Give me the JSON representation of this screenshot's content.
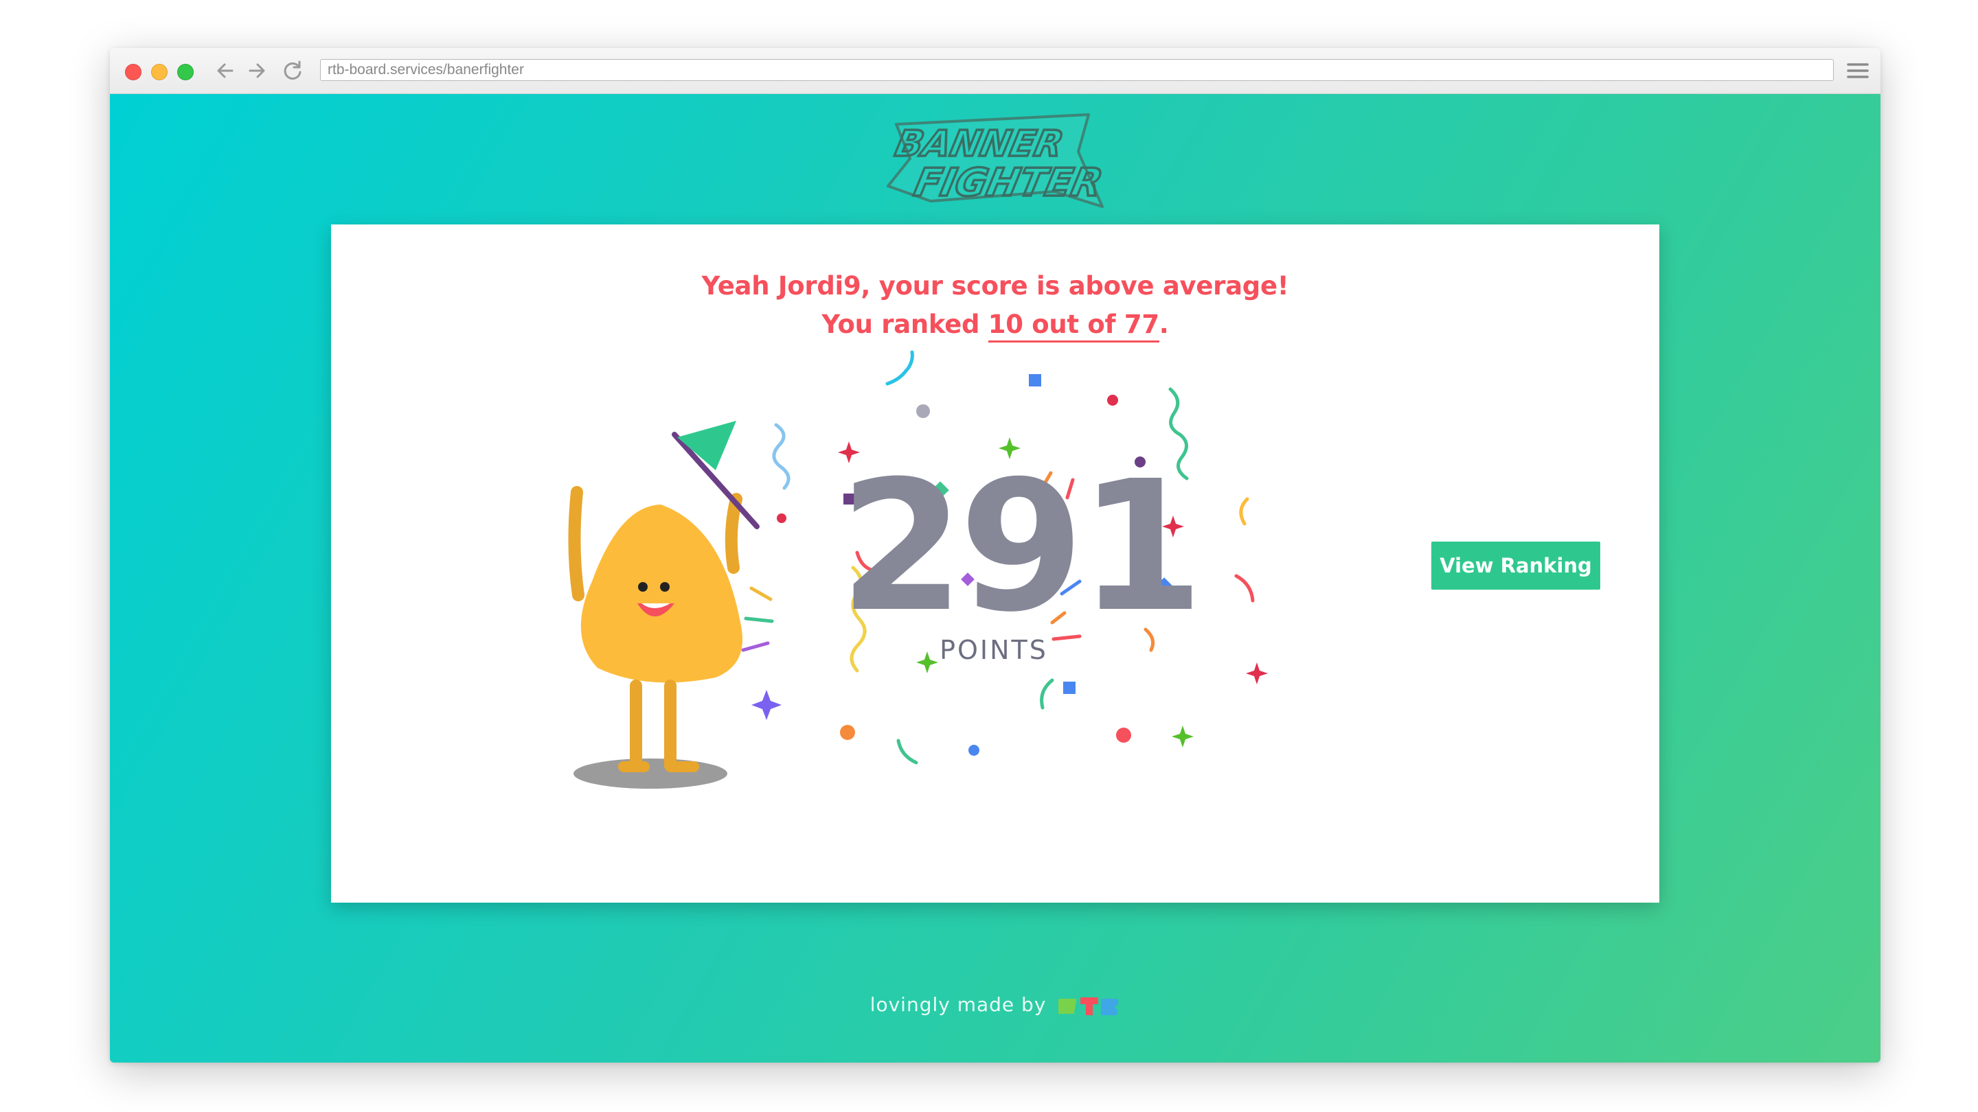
{
  "browser": {
    "url": "rtb-board.services/banerfighter"
  },
  "page": {
    "logo_text": "BANNER FIGHTER",
    "headline_line1": "Yeah Jordi9, your score is above average!",
    "rank_prefix": "You ranked ",
    "rank_link": "10 out of 77",
    "rank_suffix": ".",
    "score": "291",
    "score_unit": "POINTS",
    "view_ranking_label": "View Ranking",
    "footer_text": "lovingly made by",
    "footer_logo": "RTB"
  },
  "colors": {
    "accent": "#f5505c",
    "button": "#2ec88e",
    "score": "#868898",
    "background_start": "#00d0d4",
    "background_end": "#4cce88",
    "mascot": "#fdbb3b"
  },
  "icons": {
    "back": "arrow-left-icon",
    "forward": "arrow-right-icon",
    "reload": "reload-icon",
    "menu": "hamburger-menu-icon",
    "mascot": "mascot-with-flag-illustration",
    "confetti": "confetti-decoration"
  }
}
